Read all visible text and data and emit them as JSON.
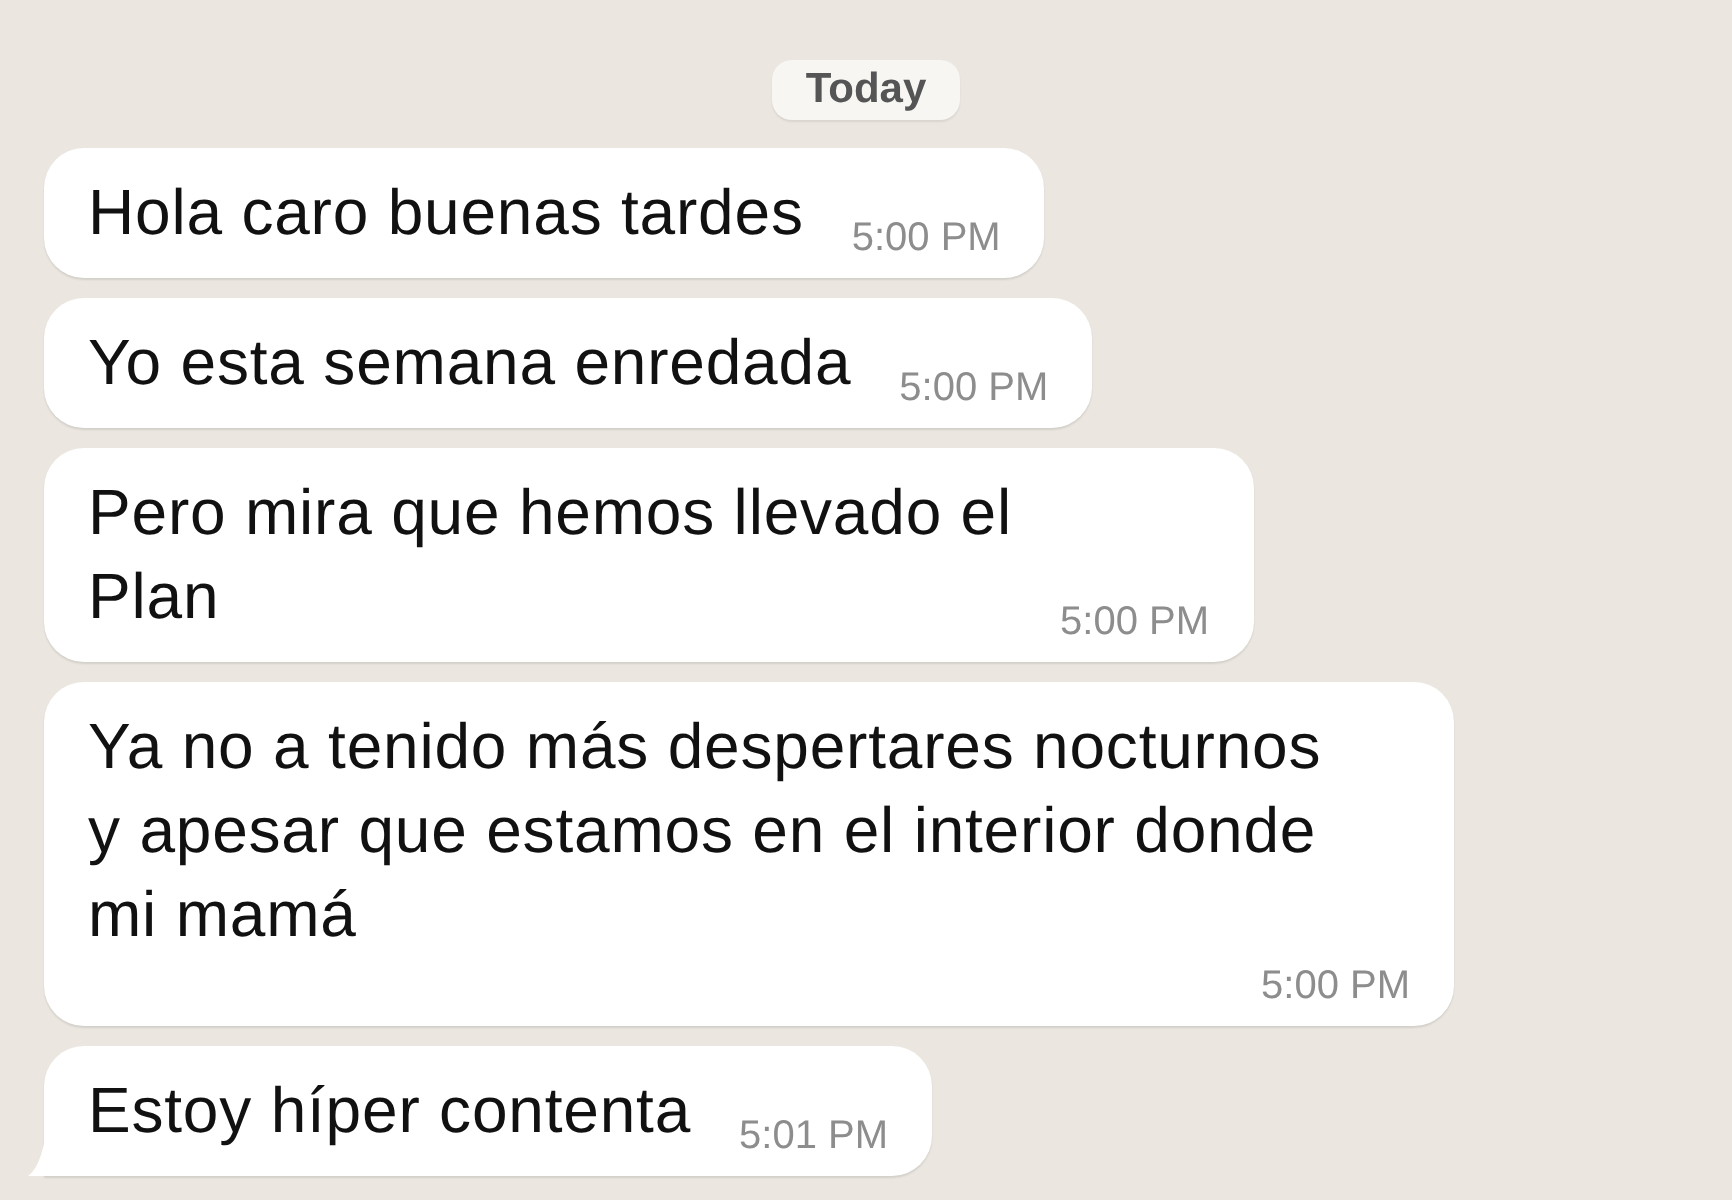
{
  "date_divider": "Today",
  "messages": [
    {
      "text": "Hola caro buenas tardes",
      "time": "5:00 PM",
      "tail": false
    },
    {
      "text": "Yo esta semana enredada",
      "time": "5:00 PM",
      "tail": false
    },
    {
      "text": "Pero mira que hemos llevado el\nPlan",
      "time": "5:00 PM",
      "tail": false
    },
    {
      "text": "Ya no a tenido más despertares nocturnos\ny apesar que estamos en el interior donde\nmi mamá",
      "time": "5:00 PM",
      "tail": false
    },
    {
      "text": "Estoy híper contenta",
      "time": "5:01 PM",
      "tail": true
    }
  ]
}
